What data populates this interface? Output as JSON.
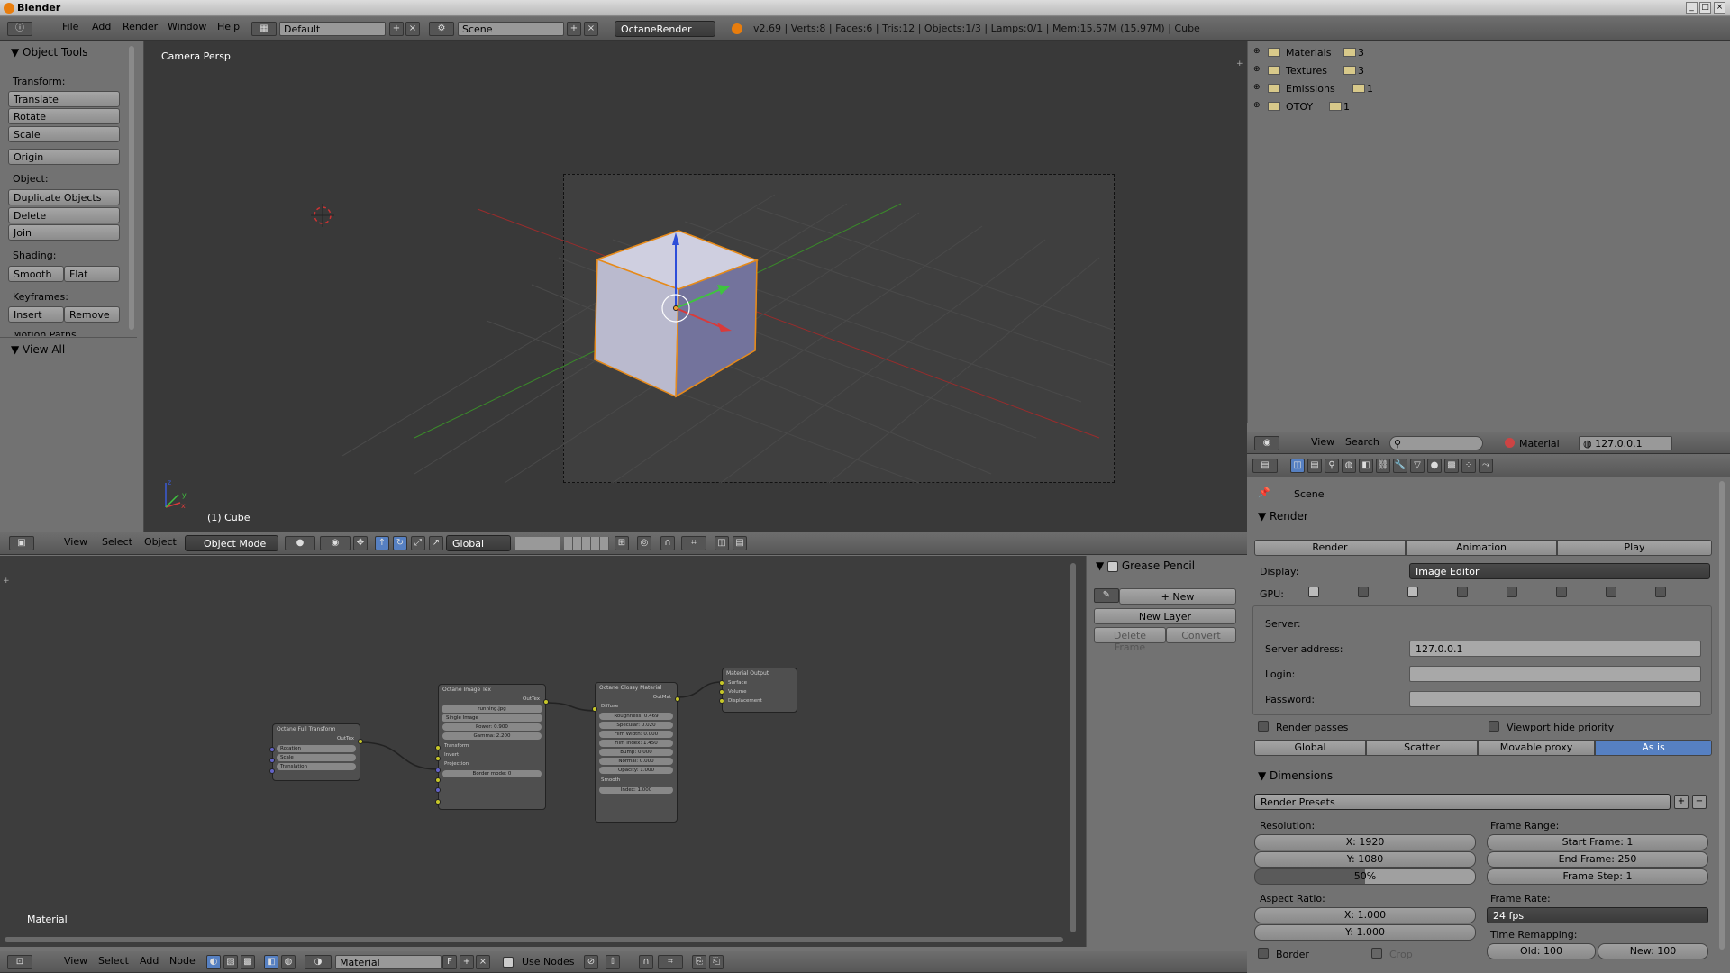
{
  "window": {
    "title": "Blender"
  },
  "top_header": {
    "menus": [
      "File",
      "Add",
      "Render",
      "Window",
      "Help"
    ],
    "layout": "Default",
    "scene": "Scene",
    "engine": "OctaneRender",
    "stats": "v2.69 | Verts:8 | Faces:6 | Tris:12 | Objects:1/3 | Lamps:0/1 | Mem:15.57M (15.97M) | Cube"
  },
  "tool_panel": {
    "title": "Object Tools",
    "transform_label": "Transform:",
    "translate": "Translate",
    "rotate": "Rotate",
    "scale": "Scale",
    "origin": "Origin",
    "object_label": "Object:",
    "duplicate": "Duplicate Objects",
    "delete": "Delete",
    "join": "Join",
    "shading_label": "Shading:",
    "smooth": "Smooth",
    "flat": "Flat",
    "keyframes_label": "Keyframes:",
    "insert": "Insert",
    "remove": "Remove",
    "motion_paths": "Motion Paths",
    "view_all": "View All"
  },
  "viewport": {
    "camera_label": "Camera Persp",
    "object_label": "(1) Cube",
    "header": {
      "view": "View",
      "select": "Select",
      "object": "Object",
      "mode": "Object Mode",
      "orientation": "Global"
    }
  },
  "outliner": {
    "items": [
      {
        "name": "Materials",
        "count": "3"
      },
      {
        "name": "Textures",
        "count": "3"
      },
      {
        "name": "Emissions",
        "count": "1"
      },
      {
        "name": "OTOY",
        "count": "1"
      }
    ],
    "header": {
      "view": "View",
      "search": "Search",
      "material": "Material",
      "address": "127.0.0.1"
    }
  },
  "properties": {
    "context": "Scene",
    "render_panel": "Render",
    "render_btn": "Render",
    "animation_btn": "Animation",
    "play_btn": "Play",
    "display_label": "Display:",
    "display_value": "Image Editor",
    "gpu_label": "GPU:",
    "server_label": "Server:",
    "server_address_label": "Server address:",
    "server_address": "127.0.0.1",
    "login_label": "Login:",
    "password_label": "Password:",
    "render_passes": "Render passes",
    "viewport_hide": "Viewport hide priority",
    "tabs": [
      "Global",
      "Scatter",
      "Movable proxy",
      "As is"
    ],
    "dimensions_panel": "Dimensions",
    "render_presets": "Render Presets",
    "resolution_label": "Resolution:",
    "res_x": "X: 1920",
    "res_y": "Y: 1080",
    "res_pct": "50%",
    "frame_range_label": "Frame Range:",
    "start_frame": "Start Frame: 1",
    "end_frame": "End Frame: 250",
    "frame_step": "Frame Step: 1",
    "aspect_label": "Aspect Ratio:",
    "aspect_x": "X: 1.000",
    "aspect_y": "Y: 1.000",
    "frame_rate_label": "Frame Rate:",
    "frame_rate": "24 fps",
    "time_remap_label": "Time Remapping:",
    "old": "Old: 100",
    "new": "New: 100",
    "border": "Border",
    "crop": "Crop"
  },
  "grease_pencil": {
    "title": "Grease Pencil",
    "new": "New",
    "new_layer": "New Layer",
    "delete_frame": "Delete Frame",
    "convert": "Convert"
  },
  "node_editor": {
    "label": "Material",
    "header": {
      "view": "View",
      "select": "Select",
      "add": "Add",
      "node": "Node",
      "material": "Material",
      "f": "F",
      "use_nodes": "Use Nodes"
    },
    "nodes": {
      "transform": {
        "title": "Octane Full Transform",
        "out": "OutTex",
        "rotation": "Rotation",
        "scale": "Scale",
        "translation": "Translation"
      },
      "image": {
        "title": "Octane Image Tex",
        "out": "OutTex",
        "file": "running.jpg",
        "mode": "Single Image",
        "power": "Power: 0.900",
        "gamma": "Gamma: 2.200",
        "transform": "Transform",
        "invert": "Invert",
        "projection": "Projection",
        "border": "Border mode: 0"
      },
      "glossy": {
        "title": "Octane Glossy Material",
        "out": "OutMat",
        "diffuse": "Diffuse",
        "roughness": "Roughness: 0.469",
        "specular": "Specular: 0.020",
        "film_width": "Film Width: 0.000",
        "film_index": "Film Index: 1.450",
        "bump": "Bump: 0.000",
        "normal": "Normal: 0.000",
        "opacity": "Opacity: 1.000",
        "smooth": "Smooth",
        "index": "Index: 1.000"
      },
      "output": {
        "title": "Material Output",
        "surface": "Surface",
        "volume": "Volume",
        "displacement": "Displacement"
      }
    }
  },
  "colors": {
    "selected_tab": "#5680c2",
    "object_outline": "#e68a1a",
    "socket_yellow": "#c7c729"
  }
}
